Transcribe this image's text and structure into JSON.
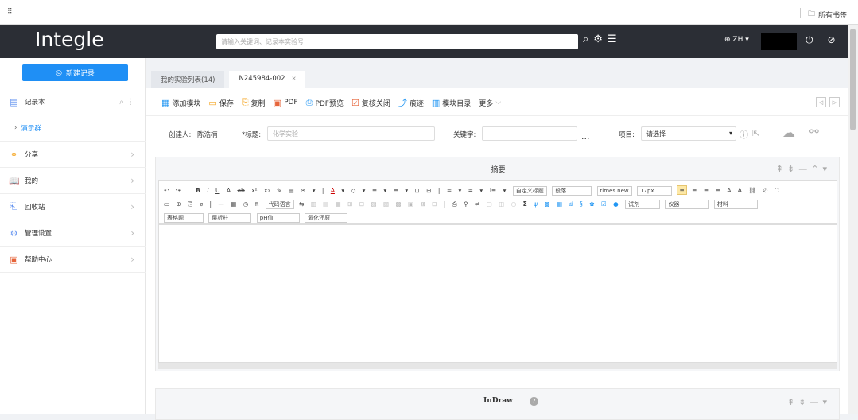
{
  "browser": {
    "apps_label": "⠿",
    "bookmarks_label": "所有书签"
  },
  "header": {
    "logo": "Integle",
    "search_placeholder": "请输入关键词、记录本实验号",
    "lang": "ZH",
    "icons": [
      "search-icon",
      "gear-icon",
      "list-icon",
      "power-icon",
      "logout-icon"
    ]
  },
  "sidebar": {
    "new_record_label": "新建记录",
    "items": [
      {
        "label": "记录本",
        "icon": "notebook-icon",
        "tail": "⌕ ⋮"
      },
      {
        "label": "演示群",
        "icon": "caret-right-icon",
        "sub": true
      },
      {
        "label": "分享",
        "icon": "share-icon"
      },
      {
        "label": "我的",
        "icon": "book-icon"
      },
      {
        "label": "回收站",
        "icon": "recycle-icon"
      },
      {
        "label": "管理设置",
        "icon": "settings-icon"
      },
      {
        "label": "帮助中心",
        "icon": "help-icon"
      }
    ]
  },
  "tabs": [
    {
      "label": "我的实验列表(14)",
      "active": false
    },
    {
      "label": "N245984-002",
      "active": true
    }
  ],
  "toolbar": [
    {
      "label": "添加模块",
      "icon": "add-module-icon"
    },
    {
      "label": "保存",
      "icon": "save-icon"
    },
    {
      "label": "复制",
      "icon": "copy-icon"
    },
    {
      "label": "PDF",
      "icon": "pdf-icon"
    },
    {
      "label": "PDF预览",
      "icon": "pdf-preview-icon"
    },
    {
      "label": "复核关闭",
      "icon": "review-icon"
    },
    {
      "label": "痕迹",
      "icon": "trace-icon"
    },
    {
      "label": "模块目录",
      "icon": "catalog-icon"
    },
    {
      "label": "更多",
      "icon": "chevron-down-icon"
    }
  ],
  "form": {
    "creator_label": "创建人:",
    "creator_value": "陈浩楠",
    "title_label": "*标题:",
    "title_placeholder": "化学实验",
    "keywords_label": "关键字:",
    "keywords_value": "",
    "more": "...",
    "project_label": "项目:",
    "project_value": "请选择"
  },
  "abstract_panel": {
    "title": "摘要",
    "editor": {
      "row1": [
        "↶",
        "↷",
        "|",
        "B",
        "I",
        "U",
        "A",
        "ab",
        "x²",
        "x₂",
        "✎",
        "▤",
        "✂",
        "▾",
        "|",
        "A",
        "▾",
        "◇",
        "▾",
        "≡",
        "▾",
        "≡",
        "▾",
        "⊡",
        "⊞",
        "|",
        "≐",
        "▾",
        "≑",
        "▾",
        "⁝≡",
        "▾"
      ],
      "custom_title": "自定义标题",
      "paragraph": "段落",
      "font": "times new",
      "size": "17px",
      "row1_tail": [
        "≡",
        "≡",
        "≡",
        "≡",
        "A",
        "A",
        "⛓",
        "∅",
        "⛶"
      ],
      "row2": [
        "▭",
        "⊕",
        "⎘",
        "⌀",
        "|",
        "—",
        "▦",
        "◷",
        "π"
      ],
      "code_lang": "代码语言",
      "row2_mid": [
        "⇆",
        "▥",
        "▤",
        "▦",
        "⊞",
        "⊟",
        "▨",
        "▧",
        "▩",
        "▣",
        "⊠",
        "⊡",
        "|",
        "⎙",
        "⚲",
        "⇌",
        "▢",
        "◫",
        "○",
        "Σ",
        "ψ",
        "▩",
        "▦",
        "ⅆ",
        "§",
        "✿",
        "☑",
        "●"
      ],
      "sample": "试剂",
      "instrument": "仪器",
      "material": "材料",
      "table_label": "表格题",
      "column": "层析柱",
      "ph": "pH值",
      "reaction": "氧化还原"
    }
  },
  "indraw_panel": {
    "title": "InDraw"
  },
  "pager": [
    "◁",
    "▷"
  ]
}
